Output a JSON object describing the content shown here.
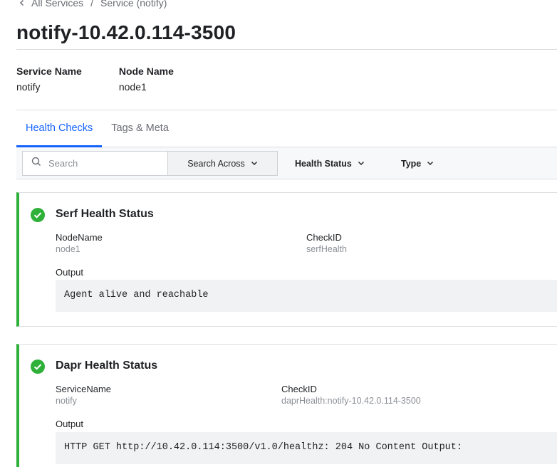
{
  "breadcrumb": {
    "back_label": "All Services",
    "separator": "/",
    "current": "Service (notify)"
  },
  "page_title": "notify-10.42.0.114-3500",
  "meta": {
    "service_name_label": "Service Name",
    "service_name_value": "notify",
    "node_name_label": "Node Name",
    "node_name_value": "node1"
  },
  "tabs": [
    {
      "label": "Health Checks",
      "active": true
    },
    {
      "label": "Tags & Meta",
      "active": false
    }
  ],
  "filters": {
    "search_placeholder": "Search",
    "search_across": "Search Across",
    "health_status": "Health Status",
    "type": "Type"
  },
  "checks": [
    {
      "status_icon": "check-circle-icon",
      "title": "Serf Health Status",
      "field1_label": "NodeName",
      "field1_value": "node1",
      "field2_label": "CheckID",
      "field2_value": "serfHealth",
      "output_label": "Output",
      "output": "Agent alive and reachable"
    },
    {
      "status_icon": "check-circle-icon",
      "title": "Dapr Health Status",
      "field1_label": "ServiceName",
      "field1_value": "notify",
      "field2_label": "CheckID",
      "field2_value": "daprHealth:notify-10.42.0.114-3500",
      "output_label": "Output",
      "output": "HTTP GET http://10.42.0.114:3500/v1.0/healthz: 204 No Content Output:"
    }
  ],
  "colors": {
    "passing": "#2eb039",
    "accent": "#1563ff"
  }
}
